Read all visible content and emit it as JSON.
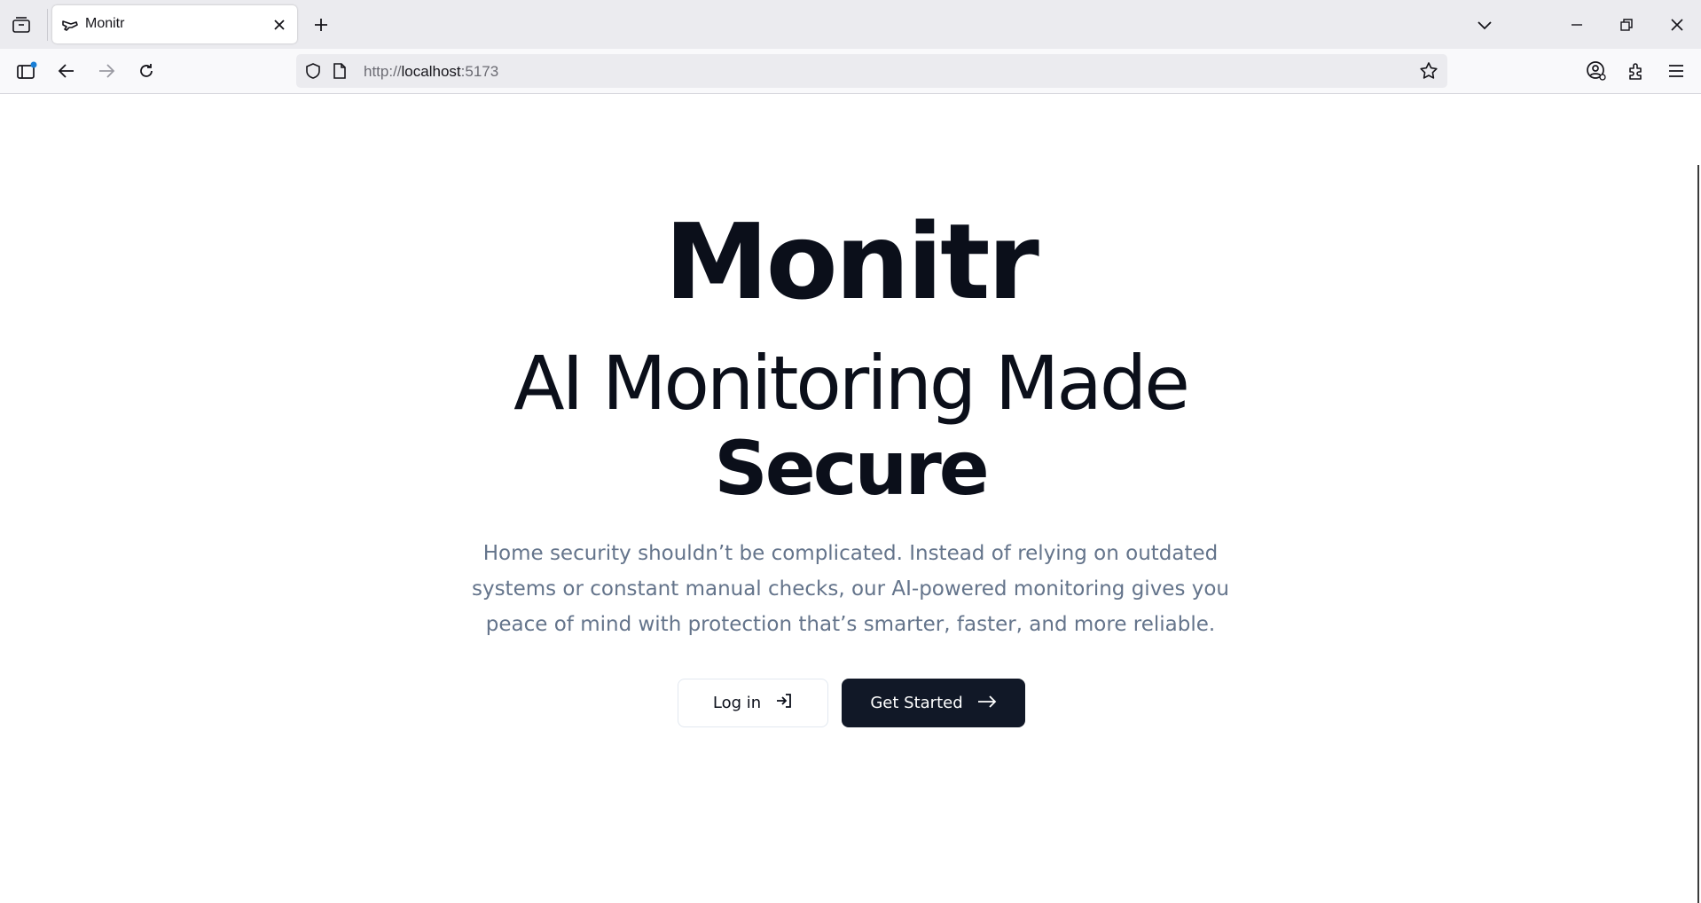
{
  "browser": {
    "tab": {
      "title": "Monitr"
    },
    "url": {
      "scheme": "http://",
      "host": "localhost",
      "port": ":5173"
    }
  },
  "hero": {
    "brand": "Monitr",
    "headline_line1": "AI Monitoring Made",
    "headline_line2": "Secure",
    "description": "Home security shouldn’t be complicated. Instead of relying on outdated systems or constant manual checks, our AI-powered monitoring gives you peace of mind with protection that’s smarter, faster, and more reliable.",
    "login_label": "Log in",
    "get_started_label": "Get Started"
  },
  "colors": {
    "primary": "#111827",
    "text": "#0b0f1a",
    "muted": "#64748b"
  },
  "icons": [
    "tab-list-icon",
    "drone-icon",
    "close-icon",
    "plus-icon",
    "chevron-down-icon",
    "minimize-icon",
    "restore-icon",
    "sidebar-icon",
    "back-arrow-icon",
    "forward-arrow-icon",
    "reload-icon",
    "shield-icon",
    "page-icon",
    "star-icon",
    "account-icon",
    "extensions-icon",
    "menu-icon",
    "login-icon",
    "arrow-right-icon"
  ]
}
